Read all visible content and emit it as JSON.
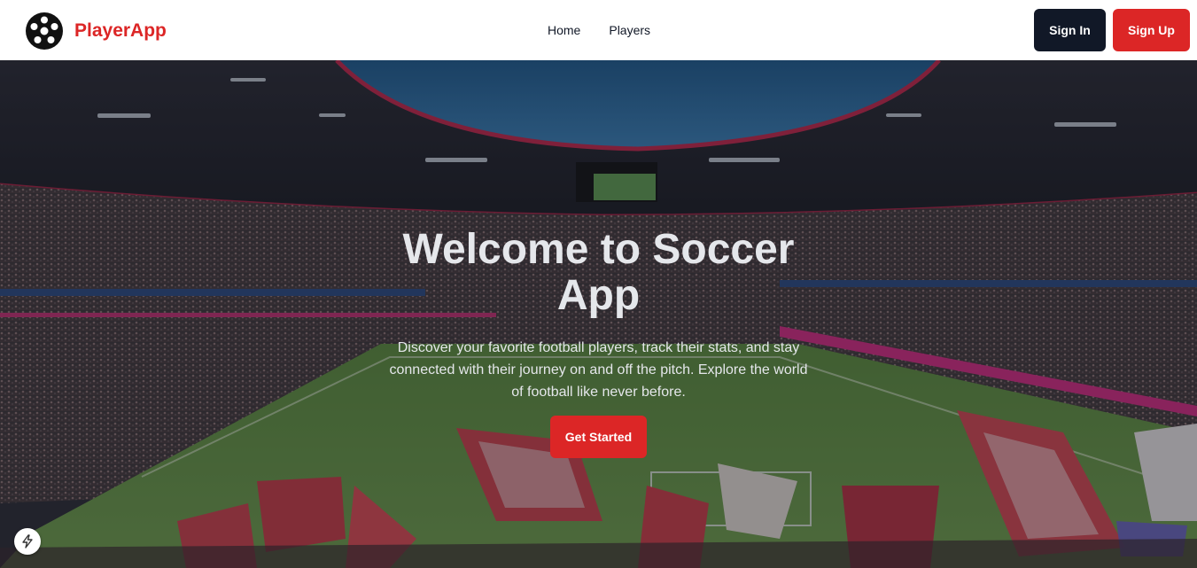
{
  "brand": {
    "name": "PlayerApp",
    "logo_icon": "soccer-ball-icon"
  },
  "nav": {
    "items": [
      {
        "label": "Home"
      },
      {
        "label": "Players"
      }
    ]
  },
  "auth": {
    "signin_label": "Sign In",
    "signup_label": "Sign Up"
  },
  "hero": {
    "title": "Welcome to Soccer App",
    "description": "Discover your favorite football players, track their stats, and stay connected with their journey on and off the pitch. Explore the world of football like never before.",
    "cta_label": "Get Started",
    "background": "stadium-image"
  },
  "floating": {
    "icon": "lightning-bolt-icon"
  },
  "colors": {
    "accent": "#dc2626",
    "dark": "#111827",
    "hero_text": "#e5e7eb"
  }
}
